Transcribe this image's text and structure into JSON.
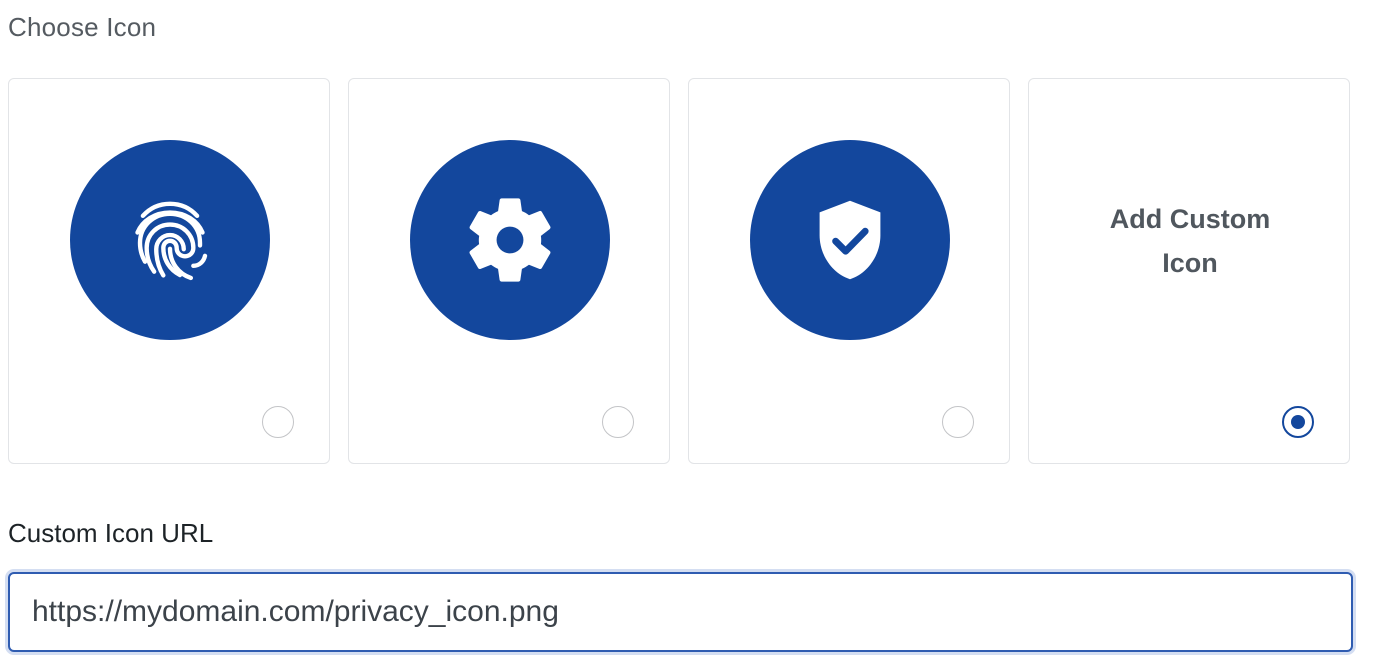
{
  "section_label": "Choose Icon",
  "icon_options": [
    {
      "icon": "fingerprint-icon",
      "selected": false
    },
    {
      "icon": "gear-icon",
      "selected": false
    },
    {
      "icon": "shield-check-icon",
      "selected": false
    },
    {
      "label_line1": "Add Custom",
      "label_line2": "Icon",
      "selected": true
    }
  ],
  "custom_url": {
    "label": "Custom Icon URL",
    "value": "https://mydomain.com/privacy_icon.png"
  },
  "colors": {
    "accent": "#13479d",
    "card_border": "#e2e4e7",
    "input_border": "#2f5cb1"
  }
}
